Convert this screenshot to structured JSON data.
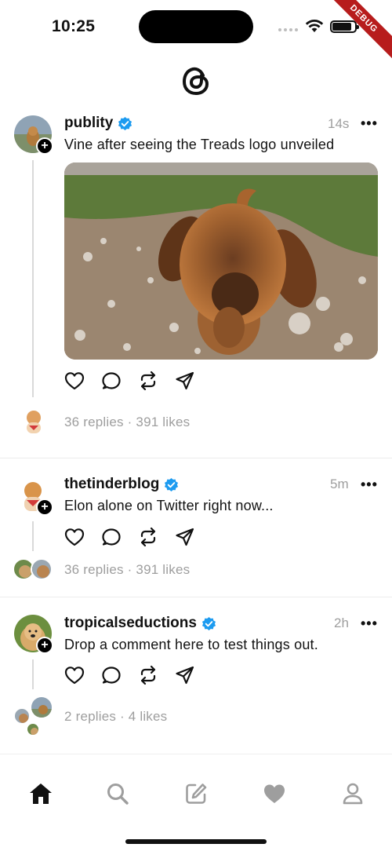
{
  "status_bar": {
    "time": "10:25",
    "debug_label": "DEBUG"
  },
  "app": {
    "logo_icon": "threads-logo-icon"
  },
  "posts": [
    {
      "username": "publity",
      "time": "14s",
      "text": "Vine after seeing the Treads logo unveiled",
      "stats": "36 replies · 391 likes",
      "verified": true,
      "has_media": true
    },
    {
      "username": "thetinderblog",
      "time": "5m",
      "text": "Elon alone on Twitter right now...",
      "stats": "36 replies · 391 likes",
      "verified": true,
      "has_media": false
    },
    {
      "username": "tropicalseductions",
      "time": "2h",
      "text": "Drop a comment here to test things out.",
      "stats": "2 replies · 4 likes",
      "verified": true,
      "has_media": false
    }
  ],
  "more_label": "•••",
  "plus_label": "+",
  "nav": [
    "home-icon",
    "search-icon",
    "compose-icon",
    "activity-heart-icon",
    "profile-icon"
  ],
  "colors": {
    "accent": "#1d9bf0",
    "muted": "#9e9e9e",
    "debug_banner": "#b71c1c"
  }
}
